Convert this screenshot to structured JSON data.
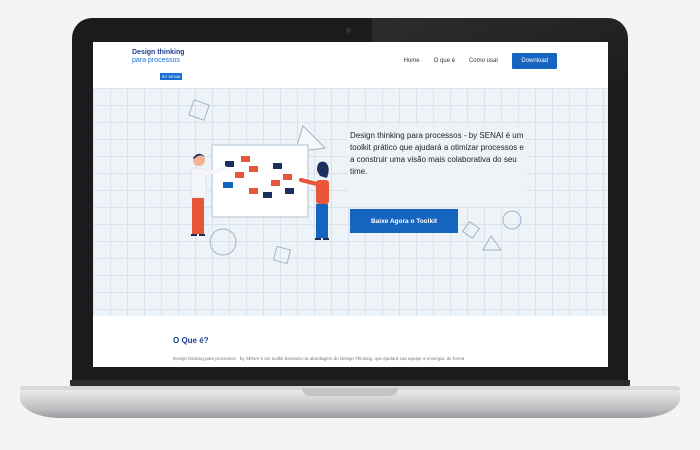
{
  "header": {
    "logo_line1": "Design thinking",
    "logo_line2": "para processos",
    "logo_badge": "BY SENAI",
    "nav": [
      "Home",
      "O que é",
      "Como usar"
    ],
    "download_label": "Download"
  },
  "hero": {
    "text": "Design thinking para processos - by SENAI é um toolkit prático que ajudará a otimizar processos e a construir uma visão mais colaborativa do seu time.",
    "button_label": "Baixe Agora o Toolkit"
  },
  "section": {
    "title": "O Que é?",
    "text": "Design thinking para processos - by SENAI é um toolkit baseado na abordagem do Design Thinking, que ajudará sua equipe a enxergar, de forma"
  },
  "colors": {
    "accent": "#1565c0",
    "brand_dark": "#1d3f8f",
    "sticky_red": "#e8553a",
    "sticky_navy": "#1d2f5c"
  }
}
